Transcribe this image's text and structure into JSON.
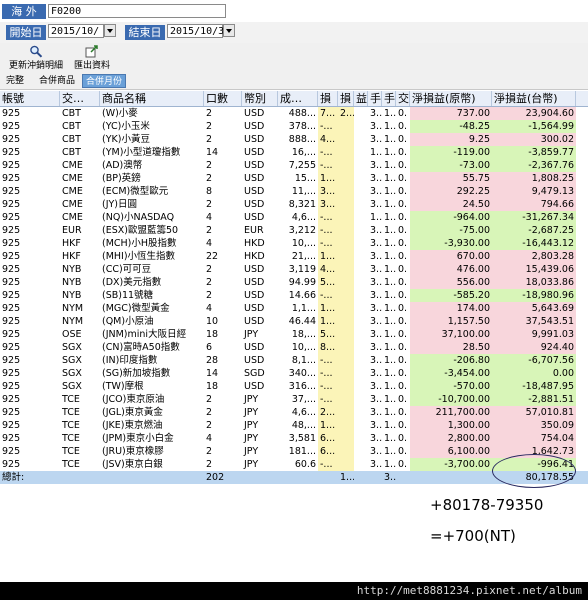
{
  "top": {
    "market_label": "海 外",
    "account_value": "F0200"
  },
  "dates": {
    "start_label": "開始日",
    "start_value": "2015/10/",
    "end_label": "結束日",
    "end_value": "2015/10/3"
  },
  "toolbar": {
    "update_label": "更新沖銷明細",
    "export_label": "匯出資料"
  },
  "tabs": [
    {
      "label": "完整"
    },
    {
      "label": "合併商品"
    },
    {
      "label": "合併月份"
    }
  ],
  "columns": [
    "帳號",
    "交…",
    "商品名稱",
    "口數",
    "幣別",
    "成…",
    "損",
    "損",
    "益",
    "手",
    "手",
    "交",
    "淨損益(原幣)",
    "淨損益(台幣)"
  ],
  "rows": [
    {
      "acct": "925",
      "ex": "CBT",
      "name": "(W)小麥",
      "qty": "2",
      "cur": "USD",
      "cost": "488...",
      "a": "7...",
      "b": "2...",
      "c": "",
      "d": "3...",
      "e": "1...",
      "f": "0.",
      "orig": "737.00",
      "twd": "23,904.60",
      "sign": "pos"
    },
    {
      "acct": "925",
      "ex": "CBT",
      "name": "(YC)小玉米",
      "qty": "2",
      "cur": "USD",
      "cost": "378...",
      "a": "-...",
      "b": "",
      "c": "",
      "d": "3...",
      "e": "1...",
      "f": "0.",
      "orig": "-48.25",
      "twd": "-1,564.99",
      "sign": "neg"
    },
    {
      "acct": "925",
      "ex": "CBT",
      "name": "(YK)小黃豆",
      "qty": "2",
      "cur": "USD",
      "cost": "888...",
      "a": "4...",
      "b": "",
      "c": "",
      "d": "3...",
      "e": "1...",
      "f": "0.",
      "orig": "9.25",
      "twd": "300.02",
      "sign": "pos"
    },
    {
      "acct": "925",
      "ex": "CBT",
      "name": "(YM)小型道瓊指數",
      "qty": "14",
      "cur": "USD",
      "cost": "16,...",
      "a": "-...",
      "b": "",
      "c": "",
      "d": "1...",
      "e": "1...",
      "f": "0.",
      "orig": "-119.00",
      "twd": "-3,859.77",
      "sign": "neg"
    },
    {
      "acct": "925",
      "ex": "CME",
      "name": "(AD)澳幣",
      "qty": "2",
      "cur": "USD",
      "cost": "7,255",
      "a": "-...",
      "b": "",
      "c": "",
      "d": "3...",
      "e": "1...",
      "f": "0.",
      "orig": "-73.00",
      "twd": "-2,367.76",
      "sign": "neg"
    },
    {
      "acct": "925",
      "ex": "CME",
      "name": "(BP)英鎊",
      "qty": "2",
      "cur": "USD",
      "cost": "15...",
      "a": "1...",
      "b": "",
      "c": "",
      "d": "3...",
      "e": "1...",
      "f": "0.",
      "orig": "55.75",
      "twd": "1,808.25",
      "sign": "pos"
    },
    {
      "acct": "925",
      "ex": "CME",
      "name": "(ECM)微型歐元",
      "qty": "8",
      "cur": "USD",
      "cost": "11,...",
      "a": "3...",
      "b": "",
      "c": "",
      "d": "3...",
      "e": "1...",
      "f": "0.",
      "orig": "292.25",
      "twd": "9,479.13",
      "sign": "pos"
    },
    {
      "acct": "925",
      "ex": "CME",
      "name": "(JY)日圓",
      "qty": "2",
      "cur": "USD",
      "cost": "8,321",
      "a": "3...",
      "b": "",
      "c": "",
      "d": "3...",
      "e": "1...",
      "f": "0.",
      "orig": "24.50",
      "twd": "794.66",
      "sign": "pos"
    },
    {
      "acct": "925",
      "ex": "CME",
      "name": "(NQ)小NASDAQ",
      "qty": "4",
      "cur": "USD",
      "cost": "4,6...",
      "a": "-...",
      "b": "",
      "c": "",
      "d": "1...",
      "e": "1...",
      "f": "0.",
      "orig": "-964.00",
      "twd": "-31,267.34",
      "sign": "neg"
    },
    {
      "acct": "925",
      "ex": "EUR",
      "name": "(ESX)歐盟藍籌50",
      "qty": "2",
      "cur": "EUR",
      "cost": "3,212",
      "a": "-...",
      "b": "",
      "c": "",
      "d": "3...",
      "e": "1...",
      "f": "0.",
      "orig": "-75.00",
      "twd": "-2,687.25",
      "sign": "neg"
    },
    {
      "acct": "925",
      "ex": "HKF",
      "name": "(MCH)小H股指數",
      "qty": "4",
      "cur": "HKD",
      "cost": "10,...",
      "a": "-...",
      "b": "",
      "c": "",
      "d": "3...",
      "e": "1...",
      "f": "0.",
      "orig": "-3,930.00",
      "twd": "-16,443.12",
      "sign": "neg"
    },
    {
      "acct": "925",
      "ex": "HKF",
      "name": "(MHI)小恆生指數",
      "qty": "22",
      "cur": "HKD",
      "cost": "21,...",
      "a": "1...",
      "b": "",
      "c": "",
      "d": "3...",
      "e": "1...",
      "f": "0.",
      "orig": "670.00",
      "twd": "2,803.28",
      "sign": "pos"
    },
    {
      "acct": "925",
      "ex": "NYB",
      "name": "(CC)可可豆",
      "qty": "2",
      "cur": "USD",
      "cost": "3,119",
      "a": "4...",
      "b": "",
      "c": "",
      "d": "3...",
      "e": "1...",
      "f": "0.",
      "orig": "476.00",
      "twd": "15,439.06",
      "sign": "pos"
    },
    {
      "acct": "925",
      "ex": "NYB",
      "name": "(DX)美元指數",
      "qty": "2",
      "cur": "USD",
      "cost": "94.99",
      "a": "5...",
      "b": "",
      "c": "",
      "d": "3...",
      "e": "1...",
      "f": "0.",
      "orig": "556.00",
      "twd": "18,033.86",
      "sign": "pos"
    },
    {
      "acct": "925",
      "ex": "NYB",
      "name": "(SB)11號糖",
      "qty": "2",
      "cur": "USD",
      "cost": "14.66",
      "a": "-...",
      "b": "",
      "c": "",
      "d": "3...",
      "e": "1...",
      "f": "0.",
      "orig": "-585.20",
      "twd": "-18,980.96",
      "sign": "neg"
    },
    {
      "acct": "925",
      "ex": "NYM",
      "name": "(MGC)微型黃金",
      "qty": "4",
      "cur": "USD",
      "cost": "1,1...",
      "a": "1...",
      "b": "",
      "c": "",
      "d": "3...",
      "e": "1...",
      "f": "0.",
      "orig": "174.00",
      "twd": "5,643.69",
      "sign": "pos"
    },
    {
      "acct": "925",
      "ex": "NYM",
      "name": "(QM)小原油",
      "qty": "10",
      "cur": "USD",
      "cost": "46.44",
      "a": "1...",
      "b": "",
      "c": "",
      "d": "3...",
      "e": "1...",
      "f": "0.",
      "orig": "1,157.50",
      "twd": "37,543.51",
      "sign": "pos"
    },
    {
      "acct": "925",
      "ex": "OSE",
      "name": "(JNM)mini大阪日經",
      "qty": "18",
      "cur": "JPY",
      "cost": "18,...",
      "a": "5...",
      "b": "",
      "c": "",
      "d": "3...",
      "e": "1...",
      "f": "0.",
      "orig": "37,100.00",
      "twd": "9,991.03",
      "sign": "pos"
    },
    {
      "acct": "925",
      "ex": "SGX",
      "name": "(CN)富時A50指數",
      "qty": "6",
      "cur": "USD",
      "cost": "10,...",
      "a": "8...",
      "b": "",
      "c": "",
      "d": "3...",
      "e": "1...",
      "f": "0.",
      "orig": "28.50",
      "twd": "924.40",
      "sign": "pos"
    },
    {
      "acct": "925",
      "ex": "SGX",
      "name": "(IN)印度指數",
      "qty": "28",
      "cur": "USD",
      "cost": "8,1...",
      "a": "-...",
      "b": "",
      "c": "",
      "d": "3...",
      "e": "1...",
      "f": "0.",
      "orig": "-206.80",
      "twd": "-6,707.56",
      "sign": "neg"
    },
    {
      "acct": "925",
      "ex": "SGX",
      "name": "(SG)新加坡指數",
      "qty": "14",
      "cur": "SGD",
      "cost": "340...",
      "a": "-...",
      "b": "",
      "c": "",
      "d": "3...",
      "e": "1...",
      "f": "0.",
      "orig": "-3,454.00",
      "twd": "0.00",
      "sign": "neg"
    },
    {
      "acct": "925",
      "ex": "SGX",
      "name": "(TW)摩根",
      "qty": "18",
      "cur": "USD",
      "cost": "316...",
      "a": "-...",
      "b": "",
      "c": "",
      "d": "3...",
      "e": "1...",
      "f": "0.",
      "orig": "-570.00",
      "twd": "-18,487.95",
      "sign": "neg"
    },
    {
      "acct": "925",
      "ex": "TCE",
      "name": "(JCO)東京原油",
      "qty": "2",
      "cur": "JPY",
      "cost": "37,...",
      "a": "-...",
      "b": "",
      "c": "",
      "d": "3...",
      "e": "1...",
      "f": "0.",
      "orig": "-10,700.00",
      "twd": "-2,881.51",
      "sign": "neg"
    },
    {
      "acct": "925",
      "ex": "TCE",
      "name": "(JGL)東京黃金",
      "qty": "2",
      "cur": "JPY",
      "cost": "4,6...",
      "a": "2...",
      "b": "",
      "c": "",
      "d": "3...",
      "e": "1...",
      "f": "0.",
      "orig": "211,700.00",
      "twd": "57,010.81",
      "sign": "pos"
    },
    {
      "acct": "925",
      "ex": "TCE",
      "name": "(JKE)東京燃油",
      "qty": "2",
      "cur": "JPY",
      "cost": "48,...",
      "a": "1...",
      "b": "",
      "c": "",
      "d": "3...",
      "e": "1...",
      "f": "0.",
      "orig": "1,300.00",
      "twd": "350.09",
      "sign": "pos"
    },
    {
      "acct": "925",
      "ex": "TCE",
      "name": "(JPM)東京小白金",
      "qty": "4",
      "cur": "JPY",
      "cost": "3,581",
      "a": "6...",
      "b": "",
      "c": "",
      "d": "3...",
      "e": "1...",
      "f": "0.",
      "orig": "2,800.00",
      "twd": "754.04",
      "sign": "pos"
    },
    {
      "acct": "925",
      "ex": "TCE",
      "name": "(JRU)東京橡膠",
      "qty": "2",
      "cur": "JPY",
      "cost": "181...",
      "a": "6...",
      "b": "",
      "c": "",
      "d": "3...",
      "e": "1...",
      "f": "0.",
      "orig": "6,100.00",
      "twd": "1,642.73",
      "sign": "pos"
    },
    {
      "acct": "925",
      "ex": "TCE",
      "name": "(JSV)東京白銀",
      "qty": "2",
      "cur": "JPY",
      "cost": "60.6",
      "a": "-...",
      "b": "",
      "c": "",
      "d": "3...",
      "e": "1...",
      "f": "0.",
      "orig": "-3,700.00",
      "twd": "-996.41",
      "sign": "neg"
    }
  ],
  "total": {
    "label": "總計:",
    "qty": "202",
    "a": "1...",
    "d": "3...",
    "twd": "80,178.55"
  },
  "annotations": {
    "line1": "+80178-79350",
    "line2": "=+700(NT)"
  },
  "watermark": "http://met8881234.pixnet.net/album"
}
